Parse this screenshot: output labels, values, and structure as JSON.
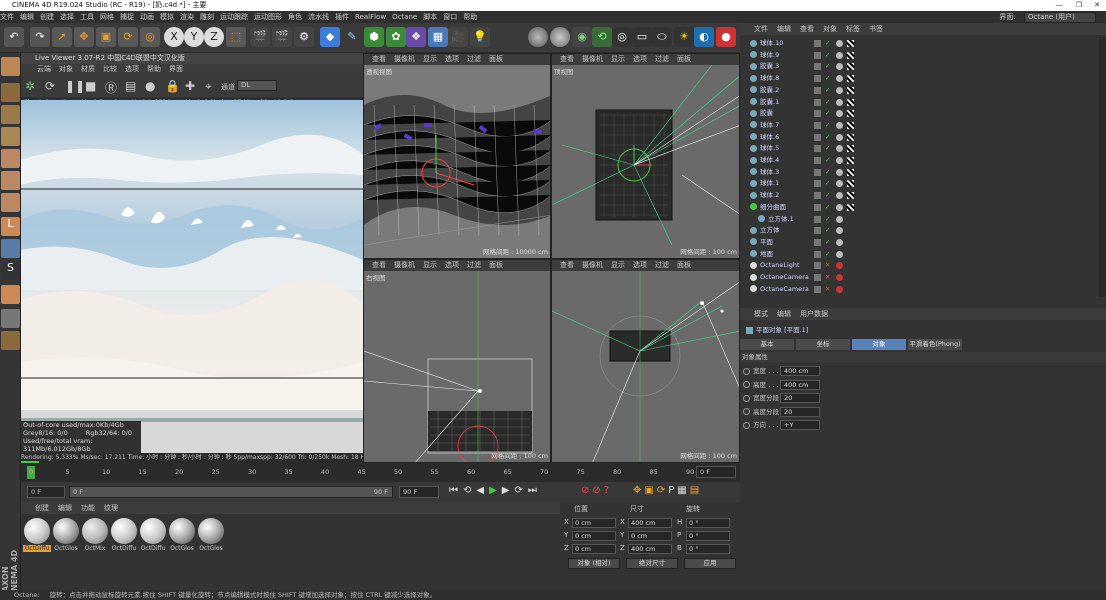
{
  "window": {
    "title": "CINEMA 4D R19.024 Studio (RC - R19) - [奶.c4d *] - 主要",
    "layout_label": "界面:",
    "layout_value": "Octane (用户)"
  },
  "menu": [
    "文件",
    "编辑",
    "创建",
    "选择",
    "工具",
    "网格",
    "捕捉",
    "动画",
    "模拟",
    "渲染",
    "雕刻",
    "运动跟踪",
    "运动图形",
    "角色",
    "流水线",
    "插件",
    "RealFlow",
    "Octane",
    "脚本",
    "窗口",
    "帮助"
  ],
  "live_viewer": {
    "title": "Live Viewer 3.07-R2 中国C4D联盟中文汉化版",
    "menu": [
      "云端",
      "对象",
      "材质",
      "比较",
      "选项",
      "帮助",
      "界面"
    ],
    "channel_label": "通道",
    "channel_value": "DL",
    "status": "Check:0ms./1ms. MeshGen:0ms. Update[C]:0ms. Mesh:1 Nodes:57 Movable:19  0 0",
    "overlay": {
      "out_of_core": "Out-of-core used/max:0Kb/4Gb",
      "grey": "Grey8/16: 0/0",
      "rgb": "Rgb32/64: 0/0",
      "vram": "Used/free/total vram: 311Mb/6.012Gb/8Gb"
    },
    "rendering": "Rendering: 5.333% Ms/sec: 17.211   Time: 小时 : 分钟 : 秒/小时 : 分钟 : 秒   Spp/maxspp: 32/600   Tri: 0/250k   Mesh: 18   Hair: 0"
  },
  "viewports": [
    {
      "label": "透视视图",
      "menu": [
        "查看",
        "摄像机",
        "显示",
        "选项",
        "过滤",
        "面板"
      ],
      "grid": "网格间距 : 10000 cm"
    },
    {
      "label": "顶视图",
      "menu": [
        "查看",
        "摄像机",
        "显示",
        "选项",
        "过滤",
        "面板"
      ],
      "grid": "网格间距 : 100 cm"
    },
    {
      "label": "右视图",
      "menu": [
        "查看",
        "摄像机",
        "显示",
        "选项",
        "过滤",
        "面板"
      ],
      "grid": "网格间距 : 100 cm"
    },
    {
      "label": "",
      "menu": [
        "查看",
        "摄像机",
        "显示",
        "选项",
        "过滤",
        "面板"
      ],
      "grid": "网格间距 : 100 cm"
    }
  ],
  "object_manager": {
    "menu": [
      "文件",
      "编辑",
      "查看",
      "对象",
      "标签",
      "书签"
    ],
    "objects": [
      "球体.10",
      "球体.9",
      "胶囊.3",
      "球体.8",
      "胶囊.2",
      "胶囊.1",
      "胶囊",
      "球体.7",
      "球体.6",
      "球体.5",
      "球体.4",
      "球体.3",
      "球体.1",
      "球体.2",
      "细分曲面",
      "立方体.1",
      "立方体",
      "平面",
      "地面",
      "OctaneLight",
      "OctaneCamera",
      "OctaneCamera"
    ]
  },
  "attributes": {
    "menu": [
      "模式",
      "编辑",
      "用户数据"
    ],
    "object_title": "平面对象 [平面.1]",
    "tabs": [
      "基本",
      "坐标",
      "对象",
      "平滑着色(Phong)"
    ],
    "section": "对象属性",
    "fields": [
      {
        "label": "宽度 . . .",
        "value": "400 cm"
      },
      {
        "label": "高度 . . .",
        "value": "400 cm"
      },
      {
        "label": "宽度分段",
        "value": "20"
      },
      {
        "label": "高度分段",
        "value": "20"
      },
      {
        "label": "方向 . . .",
        "value": "+Y"
      }
    ]
  },
  "timeline": {
    "ticks": [
      "0",
      "5",
      "10",
      "15",
      "20",
      "25",
      "30",
      "35",
      "40",
      "45",
      "50",
      "55",
      "60",
      "65",
      "70",
      "75",
      "80",
      "85",
      "90"
    ],
    "end_label": "0 F"
  },
  "anim": {
    "start": "0 F",
    "current": "0 F",
    "end": "90 F",
    "max": "90 F"
  },
  "materials": {
    "menu": [
      "创建",
      "编辑",
      "功能",
      "纹理"
    ],
    "items": [
      "OctDiffu",
      "OctGlos",
      "OctMix",
      "OctDiffu",
      "OctDiffu",
      "OctGlos",
      "OctGlos"
    ]
  },
  "coords": {
    "headers": [
      "位置",
      "尺寸",
      "旋转"
    ],
    "rows": [
      {
        "axis": "X",
        "pos": "0 cm",
        "size_axis": "X",
        "size": "400 cm",
        "rot_axis": "H",
        "rot": "0 °"
      },
      {
        "axis": "Y",
        "pos": "0 cm",
        "size_axis": "Y",
        "size": "0 cm",
        "rot_axis": "P",
        "rot": "0 °"
      },
      {
        "axis": "Z",
        "pos": "0 cm",
        "size_axis": "Z",
        "size": "400 cm",
        "rot_axis": "B",
        "rot": "0 °"
      }
    ],
    "mode": "对象 (相对)",
    "size_mode": "绝对尺寸",
    "apply": "应用"
  },
  "status": {
    "label": "Octane:",
    "text": "旋转：点击并拖动鼠标旋转元素.按住 SHIFT 键量化旋转；节点编辑模式时按住 SHIFT 键增加选择对象；按住 CTRL 键减少选择对象。"
  },
  "brand": "MAXON CINEMA 4D"
}
